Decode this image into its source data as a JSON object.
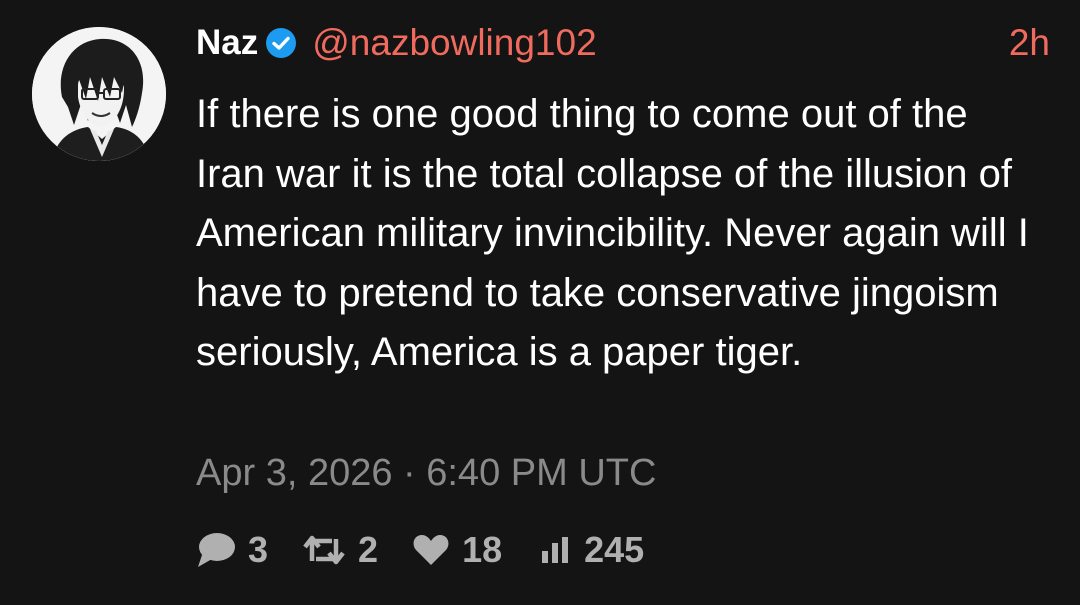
{
  "author": {
    "name": "Naz",
    "handle": "@nazbowling102",
    "verified": true,
    "time_ago": "2h",
    "avatar_icon": "avatar-anime-character"
  },
  "tweet": {
    "text": "If there is one good thing to come out of the Iran war it is the total collapse of the illusion of American military invincibility. Never again will I have to pretend to take conservative jingoism seriously, America is a paper tiger.",
    "timestamp": "Apr 3, 2026 · 6:40 PM UTC"
  },
  "metrics": {
    "replies": "3",
    "retweets": "2",
    "likes": "18",
    "views": "245"
  },
  "icons": {
    "reply": "comment-bubble-icon",
    "retweet": "retweet-icon",
    "like": "heart-icon",
    "views": "bar-chart-icon",
    "verified": "verified-badge-icon"
  },
  "colors": {
    "background": "#141414",
    "accent": "#f06b5e",
    "verified": "#1d9bf0",
    "muted": "#8a8a8a",
    "metric": "#b0b0b0"
  }
}
